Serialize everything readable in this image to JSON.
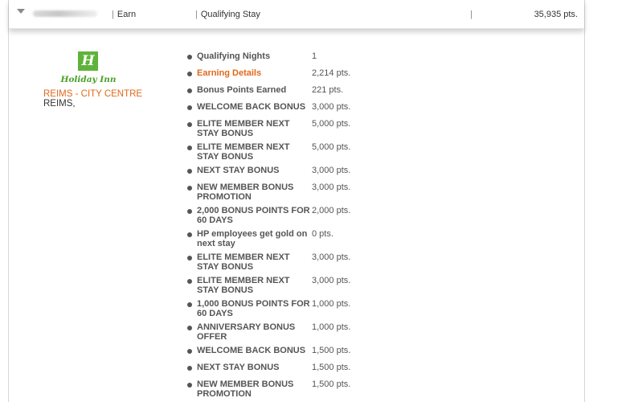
{
  "header": {
    "earn_label": "Earn",
    "type_label": "Qualifying Stay",
    "points": "35,935 pts."
  },
  "hotel": {
    "brand": "Holiday Inn",
    "logo_letter": "H",
    "name": "REIMS - CITY CENTRE",
    "city": "REIMS,"
  },
  "details": [
    {
      "label": "Qualifying Nights",
      "value": "1"
    },
    {
      "label": "Earning Details",
      "value": "2,214 pts.",
      "highlight": true
    },
    {
      "label": "Bonus Points Earned",
      "value": "221 pts."
    },
    {
      "label": "WELCOME BACK BONUS",
      "value": "3,000 pts."
    },
    {
      "label": "ELITE MEMBER NEXT STAY BONUS",
      "value": "5,000 pts."
    },
    {
      "label": "ELITE MEMBER NEXT STAY BONUS",
      "value": "5,000 pts."
    },
    {
      "label": "NEXT STAY BONUS",
      "value": "3,000 pts."
    },
    {
      "label": "NEW MEMBER BONUS PROMOTION",
      "value": "3,000 pts."
    },
    {
      "label": "2,000 BONUS POINTS FOR 60 DAYS",
      "value": "2,000 pts."
    },
    {
      "label": "HP employees get gold on next stay",
      "value": "0 pts."
    },
    {
      "label": "ELITE MEMBER NEXT STAY BONUS",
      "value": "3,000 pts."
    },
    {
      "label": "ELITE MEMBER NEXT STAY BONUS",
      "value": "3,000 pts."
    },
    {
      "label": "1,000 BONUS POINTS FOR 60 DAYS",
      "value": "1,000 pts."
    },
    {
      "label": "ANNIVERSARY BONUS OFFER",
      "value": "1,000 pts."
    },
    {
      "label": "WELCOME BACK BONUS",
      "value": "1,500 pts."
    },
    {
      "label": "NEXT STAY BONUS",
      "value": "1,500 pts."
    },
    {
      "label": "NEW MEMBER BONUS PROMOTION",
      "value": "1,500 pts."
    }
  ],
  "colors": {
    "accent_orange": "#e0691a",
    "brand_green": "#5fb33a"
  }
}
